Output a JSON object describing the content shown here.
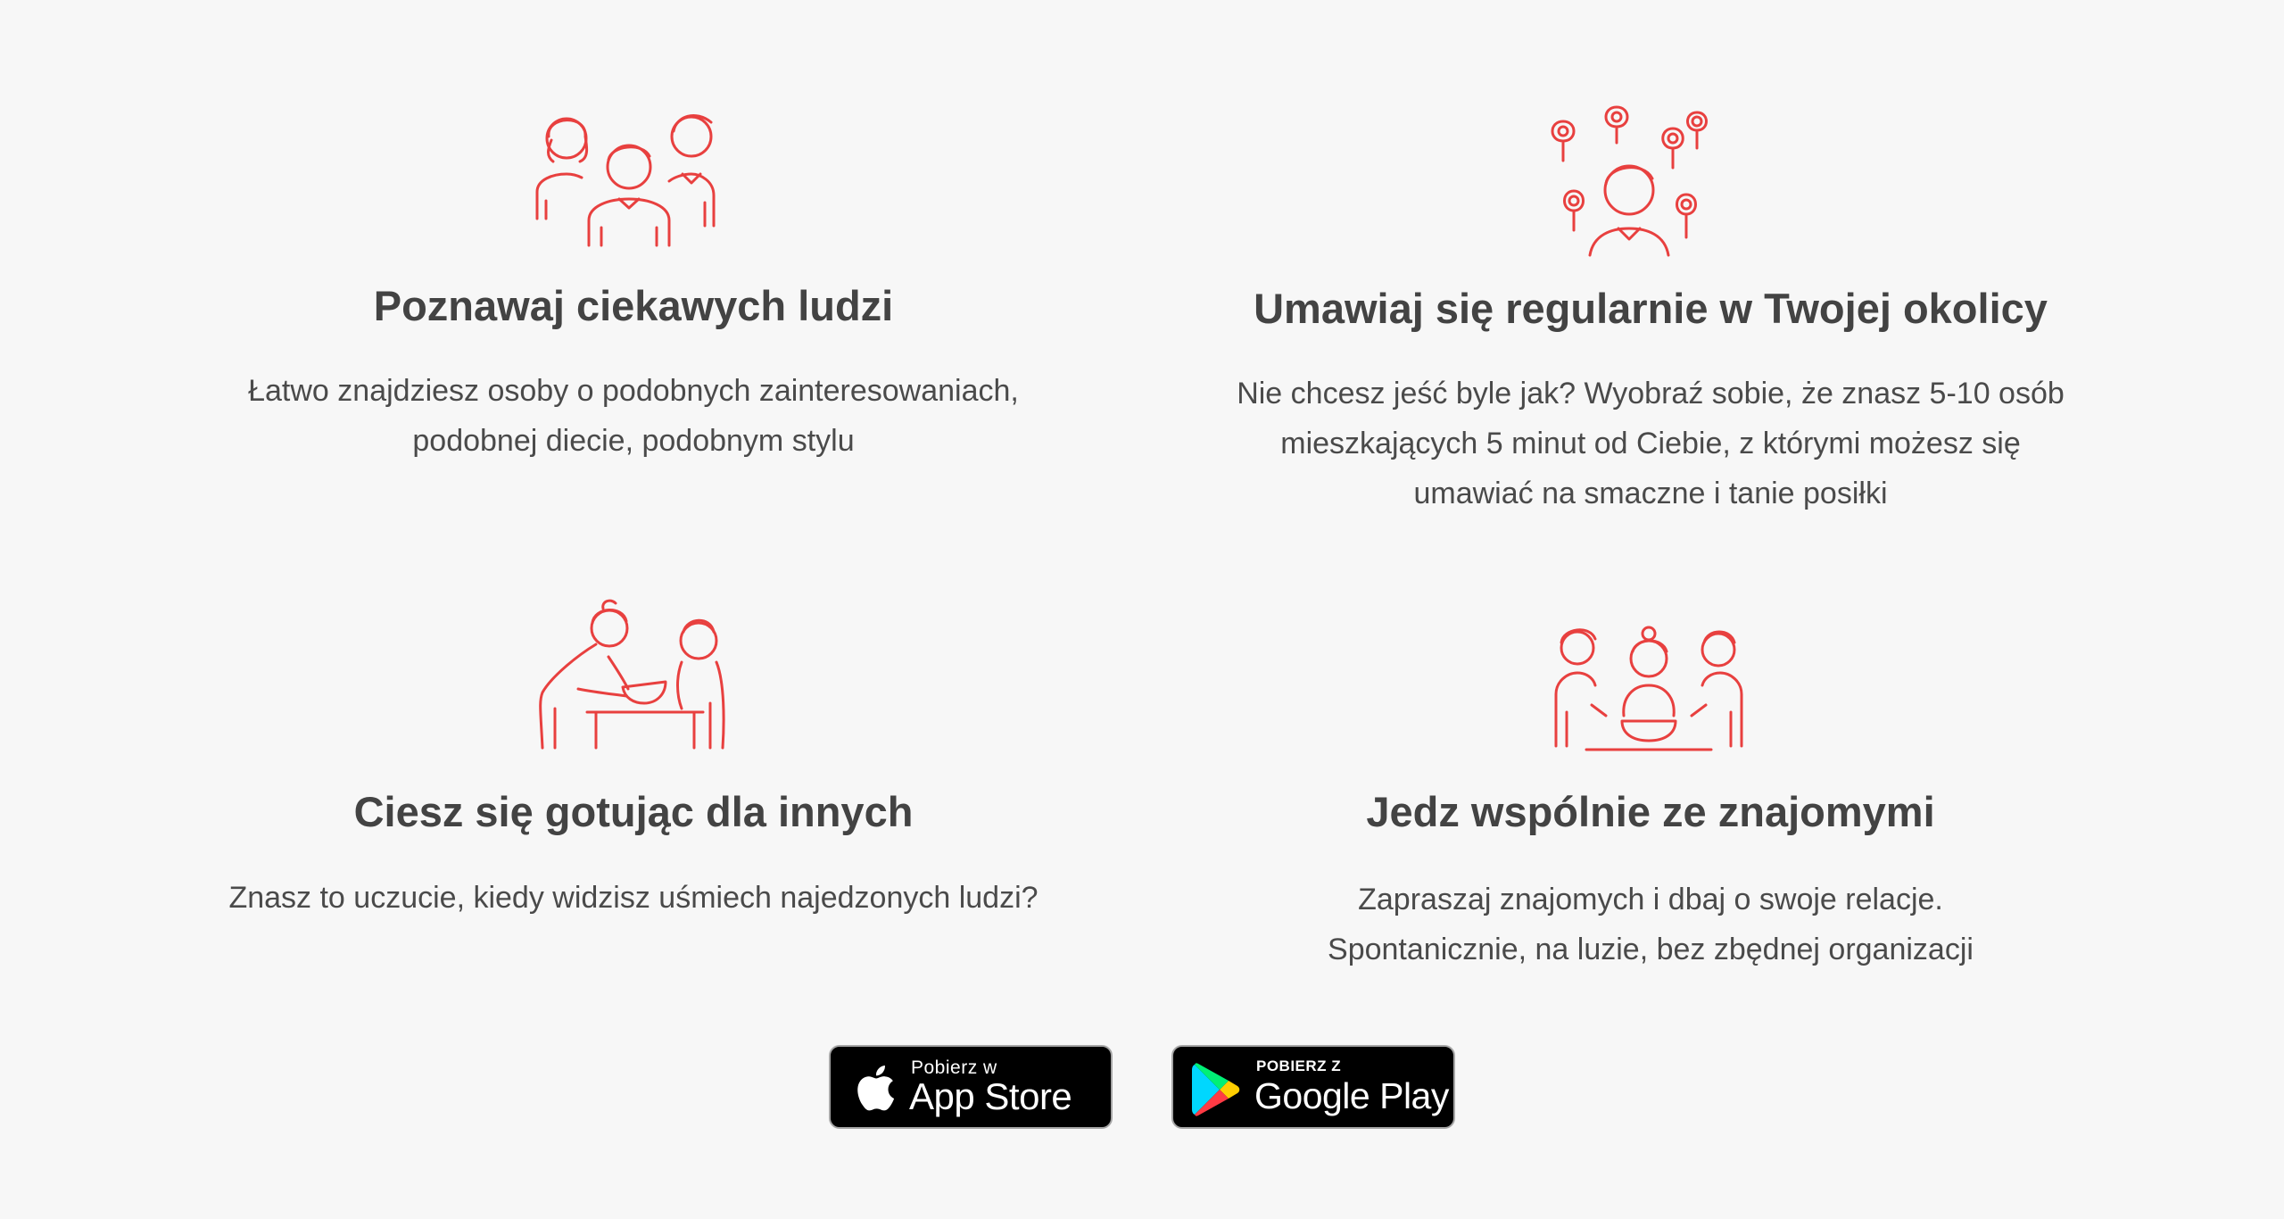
{
  "features": [
    {
      "icon": "people-group-icon",
      "title": "Poznawaj ciekawych ludzi",
      "lines": [
        "Łatwo znajdziesz osoby o podobnych zainteresowaniach,",
        "podobnej diecie, podobnym stylu"
      ]
    },
    {
      "icon": "person-location-pins-icon",
      "title": "Umawiaj się regularnie w Twojej okolicy",
      "lines": [
        "Nie chcesz jeść byle jak? Wyobraź sobie, że znasz 5-10 osób",
        "mieszkających 5 minut od Ciebie, z którymi możesz się",
        "umawiać na smaczne i tanie posiłki"
      ]
    },
    {
      "icon": "cooking-serving-icon",
      "title": "Ciesz się gotując dla innych",
      "lines": [
        "Znasz to uczucie, kiedy widzisz uśmiech najedzonych ludzi?"
      ]
    },
    {
      "icon": "eating-together-icon",
      "title": "Jedz wspólnie ze znajomymi",
      "lines": [
        "Zapraszaj znajomych i dbaj o swoje relacje.",
        "Spontanicznie, na luzie, bez zbędnej organizacji"
      ]
    }
  ],
  "stores": {
    "appstore": {
      "small": "Pobierz w",
      "big": "App Store",
      "icon": "apple-icon"
    },
    "googleplay": {
      "small": "POBIERZ Z",
      "big": "Google Play",
      "icon": "google-play-icon"
    }
  },
  "colors": {
    "accent": "#e8403f",
    "text": "#454545",
    "background": "#f7f7f7"
  }
}
